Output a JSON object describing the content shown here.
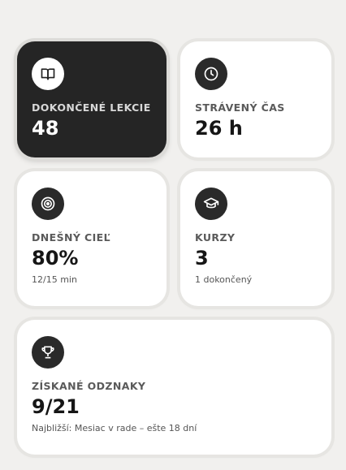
{
  "cards": [
    {
      "icon": "book-icon",
      "label": "DOKONČENÉ LEKCIE",
      "value": "48",
      "sub": ""
    },
    {
      "icon": "clock-icon",
      "label": "STRÁVENÝ ČAS",
      "value": "26 h",
      "sub": ""
    },
    {
      "icon": "target-icon",
      "label": "DNEŠNÝ CIEĽ",
      "value": "80%",
      "sub": "12/15 min"
    },
    {
      "icon": "graduation-cap-icon",
      "label": "KURZY",
      "value": "3",
      "sub": "1 dokončený"
    },
    {
      "icon": "trophy-icon",
      "label": "ZÍSKANÉ ODZNAKY",
      "value": "9/21",
      "sub": "Najbližší: Mesiac v rade – ešte 18 dní"
    }
  ],
  "colors": {
    "dark_card": "#252525",
    "card": "#ffffff",
    "background": "#f1f0ee",
    "icon_bg": "#2a2a2a"
  }
}
